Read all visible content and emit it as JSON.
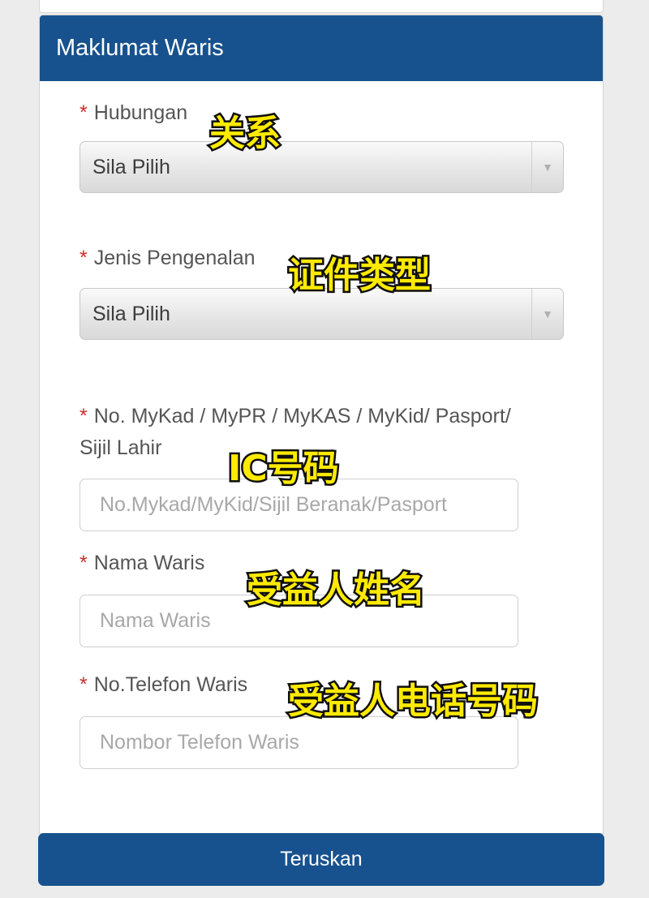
{
  "section": {
    "title": "Maklumat Waris"
  },
  "required_marker": "*",
  "fields": {
    "hubungan": {
      "label": "Hubungan",
      "value": "Sila Pilih"
    },
    "jenis_pengenalan": {
      "label": "Jenis Pengenalan",
      "value": "Sila Pilih"
    },
    "id_number": {
      "label_line1": "No. MyKad / MyPR / MyKAS / MyKid/ Pasport/",
      "label_line2": "Sijil Lahir",
      "placeholder": "No.Mykad/MyKid/Sijil Beranak/Pasport"
    },
    "nama_waris": {
      "label": "Nama Waris",
      "placeholder": "Nama Waris"
    },
    "telefon_waris": {
      "label": "No.Telefon Waris",
      "placeholder": "Nombor Telefon Waris"
    }
  },
  "annotations": {
    "relationship": "关系",
    "id_type": "证件类型",
    "ic_number": "IC号码",
    "beneficiary_name": "受益人姓名",
    "beneficiary_phone": "受益人电话号码"
  },
  "submit": {
    "label": "Teruskan"
  },
  "colors": {
    "header": "#17528f",
    "button": "#17528f",
    "required": "#c9302c",
    "annotation_fill": "#ffea00",
    "annotation_stroke": "#111111"
  },
  "icons": {
    "dropdown": "caret-down"
  }
}
